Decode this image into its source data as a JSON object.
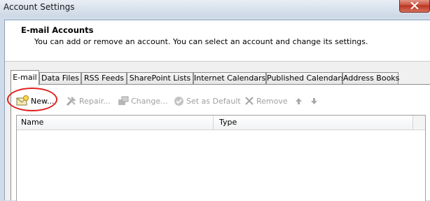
{
  "window": {
    "title": "Account Settings"
  },
  "header": {
    "title": "E-mail Accounts",
    "description": "You can add or remove an account. You can select an account and change its settings."
  },
  "tabs": [
    {
      "label": "E-mail",
      "active": true
    },
    {
      "label": "Data Files",
      "active": false
    },
    {
      "label": "RSS Feeds",
      "active": false
    },
    {
      "label": "SharePoint Lists",
      "active": false
    },
    {
      "label": "Internet Calendars",
      "active": false
    },
    {
      "label": "Published Calendars",
      "active": false
    },
    {
      "label": "Address Books",
      "active": false
    }
  ],
  "toolbar": {
    "new_label": "New...",
    "repair_label": "Repair...",
    "change_label": "Change...",
    "default_label": "Set as Default",
    "remove_label": "Remove"
  },
  "list": {
    "columns": [
      "Name",
      "Type"
    ]
  },
  "colors": {
    "annotation": "#e02020",
    "disabled_text": "#a0a0a0",
    "close_button": "#c9523e"
  }
}
